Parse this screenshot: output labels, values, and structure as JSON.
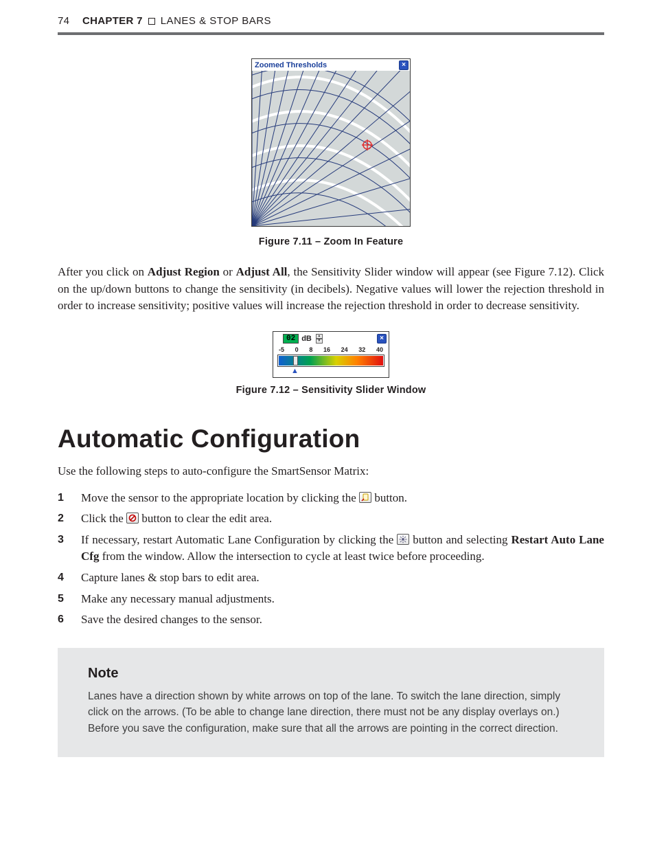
{
  "header": {
    "page_number": "74",
    "chapter_label": "CHAPTER 7",
    "section_title": "LANES & STOP BARS"
  },
  "fig711": {
    "window_title": "Zoomed Thresholds",
    "caption": "Figure 7.11 – Zoom In Feature"
  },
  "para_after_fig711": {
    "pre": "After you click on ",
    "b1": "Adjust Region",
    "mid1": " or ",
    "b2": "Adjust All",
    "rest": ", the Sensitivity Slider window will appear (see Figure 7.12). Click on the up/down buttons to change the sensitivity (in decibels). Negative values will lower the rejection threshold in order to increase sensitivity; positive values will increase the rejection threshold in order to decrease sensitivity."
  },
  "fig712": {
    "db_value": "02",
    "db_unit": "dB",
    "ticks": [
      "-5",
      "0",
      "8",
      "16",
      "24",
      "32",
      "40"
    ],
    "caption": "Figure 7.12 – Sensitivity Slider Window"
  },
  "heading": "Automatic Configuration",
  "lead": "Use the following steps to auto-configure the SmartSensor Matrix:",
  "steps": [
    {
      "pre": "Move the sensor to the appropriate location by clicking the ",
      "post": " button."
    },
    {
      "pre": "Click the ",
      "post": " button to clear the edit area."
    },
    {
      "pre": "If necessary, restart Automatic Lane Configuration by clicking the ",
      "mid": " button and selecting ",
      "bold": "Restart Auto Lane Cfg",
      "post": " from the window. Allow the intersection to cycle at least twice before proceeding."
    },
    {
      "text": "Capture lanes & stop bars to edit area."
    },
    {
      "text": "Make any necessary manual adjustments."
    },
    {
      "text": "Save the desired changes to the sensor."
    }
  ],
  "note": {
    "title": "Note",
    "body": "Lanes have a direction shown by white arrows on top of the lane. To switch the lane direction, simply click on the arrows. (To be able to change lane direction, there must not be any display overlays on.) Before you save the configuration, make sure that all the arrows are pointing in the correct direction."
  }
}
